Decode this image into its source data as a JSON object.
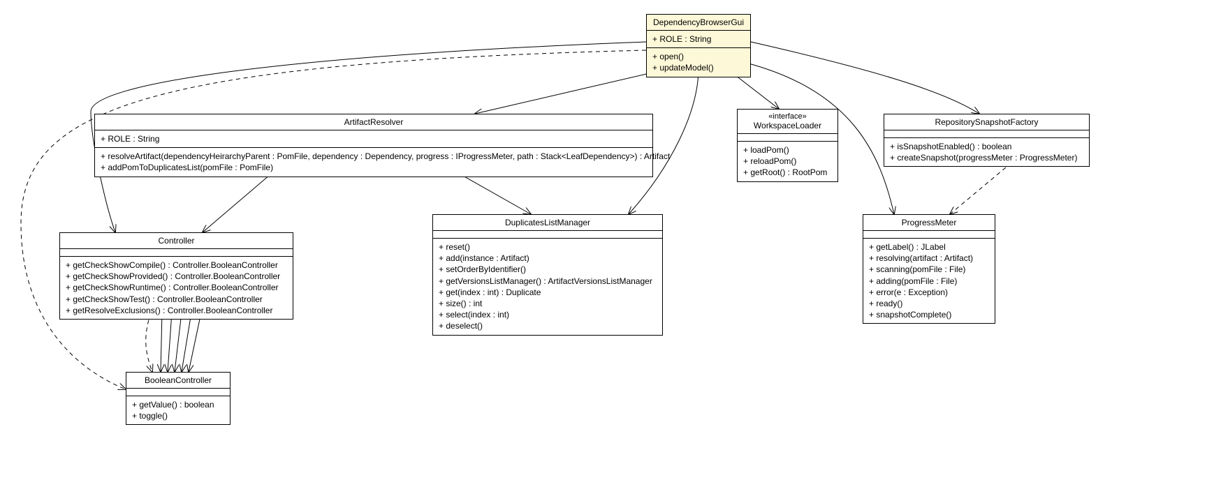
{
  "classes": {
    "dependencyBrowserGui": {
      "name": "DependencyBrowserGui",
      "attrs": [
        "+ ROLE : String"
      ],
      "ops": [
        "+ open()",
        "+ updateModel()"
      ]
    },
    "artifactResolver": {
      "name": "ArtifactResolver",
      "attrs": [
        "+ ROLE : String"
      ],
      "ops": [
        "+ resolveArtifact(dependencyHeirarchyParent : PomFile, dependency : Dependency, progress : IProgressMeter, path : Stack<LeafDependency>) : Artifact",
        "+ addPomToDuplicatesList(pomFile : PomFile)"
      ]
    },
    "workspaceLoader": {
      "stereotype": "«interface»",
      "name": "WorkspaceLoader",
      "ops": [
        "+ loadPom()",
        "+ reloadPom()",
        "+ getRoot() : RootPom"
      ]
    },
    "repositorySnapshotFactory": {
      "name": "RepositorySnapshotFactory",
      "ops": [
        "+ isSnapshotEnabled() : boolean",
        "+ createSnapshot(progressMeter : ProgressMeter)"
      ]
    },
    "controller": {
      "name": "Controller",
      "ops": [
        "+ getCheckShowCompile() : Controller.BooleanController",
        "+ getCheckShowProvided() : Controller.BooleanController",
        "+ getCheckShowRuntime() : Controller.BooleanController",
        "+ getCheckShowTest() : Controller.BooleanController",
        "+ getResolveExclusions() : Controller.BooleanController"
      ]
    },
    "duplicatesListManager": {
      "name": "DuplicatesListManager",
      "ops": [
        "+ reset()",
        "+ add(instance : Artifact)",
        "+ setOrderByIdentifier()",
        "+ getVersionsListManager() : ArtifactVersionsListManager",
        "+ get(index : int) : Duplicate",
        "+ size() : int",
        "+ select(index : int)",
        "+ deselect()"
      ]
    },
    "progressMeter": {
      "name": "ProgressMeter",
      "ops": [
        "+ getLabel() : JLabel",
        "+ resolving(artifact : Artifact)",
        "+ scanning(pomFile : File)",
        "+ adding(pomFile : File)",
        "+ error(e : Exception)",
        "+ ready()",
        "+ snapshotComplete()"
      ]
    },
    "booleanController": {
      "name": "BooleanController",
      "ops": [
        "+ getValue() : boolean",
        "+ toggle()"
      ]
    }
  }
}
